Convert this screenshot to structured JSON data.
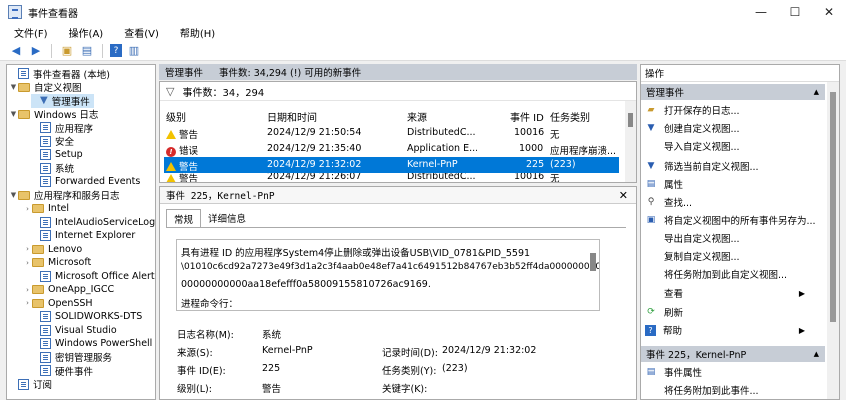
{
  "window": {
    "title": "事件查看器",
    "minimize": "—",
    "maximize": "☐",
    "close": "✕"
  },
  "menu": [
    "文件(F)",
    "操作(A)",
    "查看(V)",
    "帮助(H)"
  ],
  "tree": {
    "root": "事件查看器 (本地)",
    "custom_views": "自定义视图",
    "admin_events": "管理事件",
    "windows_logs": "Windows 日志",
    "logs": [
      "应用程序",
      "安全",
      "Setup",
      "系统",
      "Forwarded Events"
    ],
    "app_services": "应用程序和服务日志",
    "folders": [
      "Intel",
      "IntelAudioServiceLog",
      "Internet Explorer",
      "Lenovo",
      "Microsoft",
      "Microsoft Office Alerts",
      "OneApp_IGCC",
      "OpenSSH",
      "SOLIDWORKS-DTS",
      "Visual Studio",
      "Windows PowerShell",
      "密钥管理服务",
      "硬件事件"
    ],
    "subscriptions": "订阅"
  },
  "center": {
    "header_title": "管理事件",
    "header_count": "事件数: 34,294 (!) 可用的新事件",
    "filter_text": "事件数：34，294",
    "columns": [
      "级别",
      "日期和时间",
      "来源",
      "事件 ID",
      "任务类别"
    ],
    "rows": [
      {
        "level": "警告",
        "icon": "warning-icon",
        "datetime": "2024/12/9 21:50:54",
        "source": "DistributedC...",
        "id": "10016",
        "task": "无"
      },
      {
        "level": "错误",
        "icon": "error-icon",
        "datetime": "2024/12/9 21:35:40",
        "source": "Application E...",
        "id": "1000",
        "task": "应用程序崩溃..."
      },
      {
        "level": "警告",
        "icon": "warning-icon",
        "datetime": "2024/12/9 21:32:02",
        "source": "Kernel-PnP",
        "id": "225",
        "task": "(223)"
      },
      {
        "level": "警告",
        "icon": "warning-icon",
        "datetime": "2024/12/9 21:26:07",
        "source": "DistributedC...",
        "id": "10016",
        "task": "无"
      }
    ],
    "selected_row": 2
  },
  "detail": {
    "title": "事件 225，Kernel-PnP",
    "tabs": [
      "常规",
      "详细信息"
    ],
    "message": [
      "具有进程 ID 的应用程序System4停止删除或弹出设备USB\\VID_0781&PID_5591",
      "\\01010c6cd92a7273e49f3d1a2c3f4aab0e48ef7a41c6491512b84767eb3b52ff4da0000000000",
      "00000000000aa18efefff0a58009155810726ac9169.",
      "进程命令行："
    ],
    "fields": {
      "log_name_label": "日志名称(M):",
      "log_name": "系统",
      "source_label": "来源(S):",
      "source": "Kernel-PnP",
      "recorded_label": "记录时间(D):",
      "recorded": "2024/12/9 21:32:02",
      "event_id_label": "事件 ID(E):",
      "event_id": "225",
      "task_label": "任务类别(Y):",
      "task": "(223)",
      "level_label": "级别(L):",
      "level": "警告",
      "keywords_label": "关键字(K):"
    }
  },
  "actions": {
    "header": "操作",
    "section1": "管理事件",
    "items1": [
      {
        "label": "打开保存的日志...",
        "icon": "folder-open-icon"
      },
      {
        "label": "创建自定义视图...",
        "icon": "filter-icon"
      },
      {
        "label": "导入自定义视图...",
        "icon": "import-icon"
      },
      {
        "label": "筛选当前自定义视图...",
        "icon": "filter-icon"
      },
      {
        "label": "属性",
        "icon": "properties-icon"
      },
      {
        "label": "查找...",
        "icon": "find-icon"
      },
      {
        "label": "将自定义视图中的所有事件另存为...",
        "icon": "save-icon"
      },
      {
        "label": "导出自定义视图...",
        "icon": "export-icon"
      },
      {
        "label": "复制自定义视图...",
        "icon": "copy-icon"
      },
      {
        "label": "将任务附加到此自定义视图...",
        "icon": "attach-task-icon"
      },
      {
        "label": "查看",
        "icon": "view-icon"
      },
      {
        "label": "刷新",
        "icon": "refresh-icon"
      },
      {
        "label": "帮助",
        "icon": "help-icon"
      }
    ],
    "section2": "事件 225，Kernel-PnP",
    "items2": [
      {
        "label": "事件属性",
        "icon": "event-properties-icon"
      },
      {
        "label": "将任务附加到此事件...",
        "icon": "attach-task-icon"
      }
    ]
  }
}
